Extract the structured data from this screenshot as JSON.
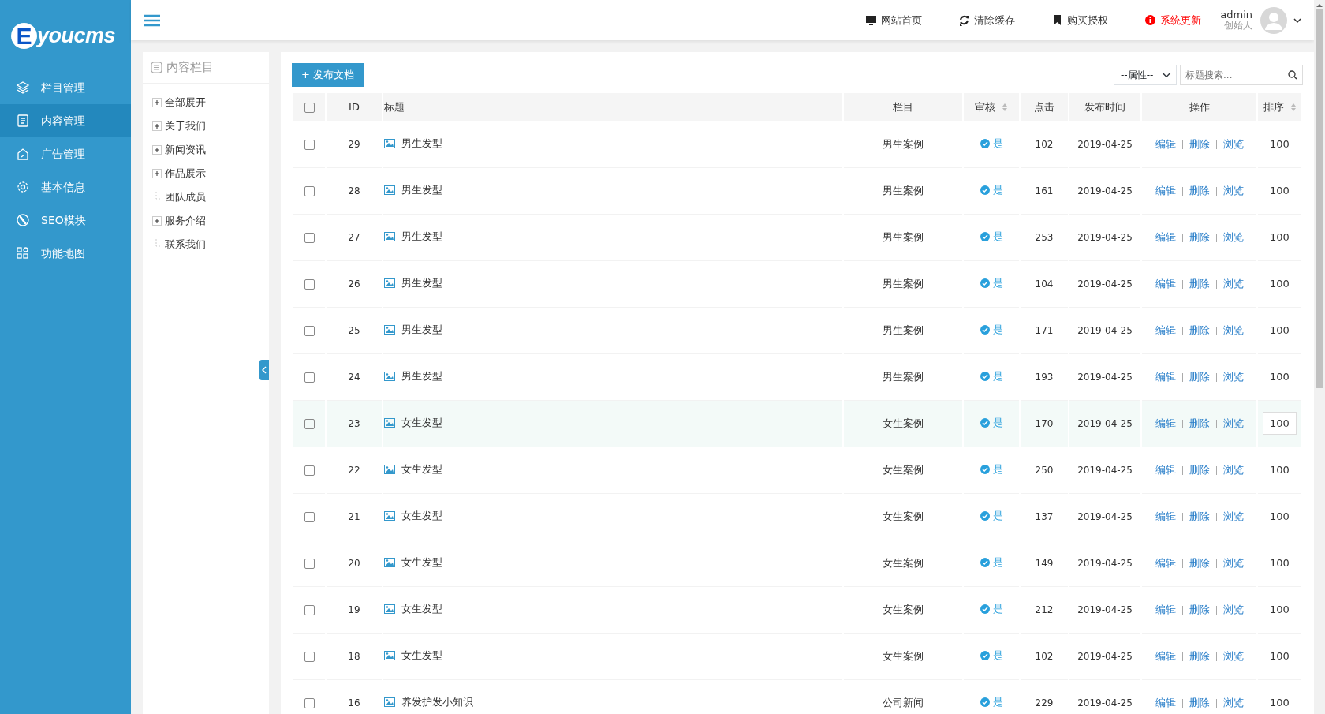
{
  "logo": {
    "letter": "E",
    "text": "youcms"
  },
  "sidebar": {
    "items": [
      {
        "label": "栏目管理",
        "selected": false
      },
      {
        "label": "内容管理",
        "selected": true
      },
      {
        "label": "广告管理",
        "selected": false
      },
      {
        "label": "基本信息",
        "selected": false
      },
      {
        "label": "SEO模块",
        "selected": false
      },
      {
        "label": "功能地图",
        "selected": false
      }
    ]
  },
  "topbar": {
    "links": [
      {
        "label": "网站首页",
        "kind": "normal"
      },
      {
        "label": "清除缓存",
        "kind": "normal"
      },
      {
        "label": "购买授权",
        "kind": "normal"
      },
      {
        "label": "系统更新",
        "kind": "alert"
      }
    ],
    "user": {
      "name": "admin",
      "role": "创始人"
    }
  },
  "tree": {
    "title": "内容栏目",
    "items": [
      {
        "label": "全部展开",
        "expandable": true
      },
      {
        "label": "关于我们",
        "expandable": true
      },
      {
        "label": "新闻资讯",
        "expandable": true
      },
      {
        "label": "作品展示",
        "expandable": true
      },
      {
        "label": "团队成员",
        "expandable": false
      },
      {
        "label": "服务介绍",
        "expandable": true
      },
      {
        "label": "联系我们",
        "expandable": false
      }
    ]
  },
  "toolbar": {
    "publish_button": "+ 发布文档",
    "filter": "--属性--",
    "search": {
      "placeholder": "标题搜索..."
    }
  },
  "table": {
    "select_all_checked": false,
    "columns": [
      {
        "label": "ID",
        "sortable": false
      },
      {
        "label": "标题",
        "sortable": false
      },
      {
        "label": "栏目",
        "sortable": false
      },
      {
        "label": "审核",
        "sortable": true
      },
      {
        "label": "点击",
        "sortable": false
      },
      {
        "label": "发布时间",
        "sortable": false
      },
      {
        "label": "操作",
        "sortable": false
      },
      {
        "label": "排序",
        "sortable": true
      }
    ],
    "rows": [
      {
        "id": "29",
        "title": "男生发型",
        "category": "男生案例",
        "approved": "是",
        "clicks": "102",
        "date": "2019-04-25",
        "actions": [
          "编辑",
          "删除",
          "浏览"
        ],
        "order": "100",
        "checked": false,
        "hovered": false
      },
      {
        "id": "28",
        "title": "男生发型",
        "category": "男生案例",
        "approved": "是",
        "clicks": "161",
        "date": "2019-04-25",
        "actions": [
          "编辑",
          "删除",
          "浏览"
        ],
        "order": "100",
        "checked": false,
        "hovered": false
      },
      {
        "id": "27",
        "title": "男生发型",
        "category": "男生案例",
        "approved": "是",
        "clicks": "253",
        "date": "2019-04-25",
        "actions": [
          "编辑",
          "删除",
          "浏览"
        ],
        "order": "100",
        "checked": false,
        "hovered": false
      },
      {
        "id": "26",
        "title": "男生发型",
        "category": "男生案例",
        "approved": "是",
        "clicks": "104",
        "date": "2019-04-25",
        "actions": [
          "编辑",
          "删除",
          "浏览"
        ],
        "order": "100",
        "checked": false,
        "hovered": false
      },
      {
        "id": "25",
        "title": "男生发型",
        "category": "男生案例",
        "approved": "是",
        "clicks": "171",
        "date": "2019-04-25",
        "actions": [
          "编辑",
          "删除",
          "浏览"
        ],
        "order": "100",
        "checked": false,
        "hovered": false
      },
      {
        "id": "24",
        "title": "男生发型",
        "category": "男生案例",
        "approved": "是",
        "clicks": "193",
        "date": "2019-04-25",
        "actions": [
          "编辑",
          "删除",
          "浏览"
        ],
        "order": "100",
        "checked": false,
        "hovered": false
      },
      {
        "id": "23",
        "title": "女生发型",
        "category": "女生案例",
        "approved": "是",
        "clicks": "170",
        "date": "2019-04-25",
        "actions": [
          "编辑",
          "删除",
          "浏览"
        ],
        "order": "100",
        "checked": false,
        "hovered": true
      },
      {
        "id": "22",
        "title": "女生发型",
        "category": "女生案例",
        "approved": "是",
        "clicks": "250",
        "date": "2019-04-25",
        "actions": [
          "编辑",
          "删除",
          "浏览"
        ],
        "order": "100",
        "checked": false,
        "hovered": false
      },
      {
        "id": "21",
        "title": "女生发型",
        "category": "女生案例",
        "approved": "是",
        "clicks": "137",
        "date": "2019-04-25",
        "actions": [
          "编辑",
          "删除",
          "浏览"
        ],
        "order": "100",
        "checked": false,
        "hovered": false
      },
      {
        "id": "20",
        "title": "女生发型",
        "category": "女生案例",
        "approved": "是",
        "clicks": "149",
        "date": "2019-04-25",
        "actions": [
          "编辑",
          "删除",
          "浏览"
        ],
        "order": "100",
        "checked": false,
        "hovered": false
      },
      {
        "id": "19",
        "title": "女生发型",
        "category": "女生案例",
        "approved": "是",
        "clicks": "212",
        "date": "2019-04-25",
        "actions": [
          "编辑",
          "删除",
          "浏览"
        ],
        "order": "100",
        "checked": false,
        "hovered": false
      },
      {
        "id": "18",
        "title": "女生发型",
        "category": "女生案例",
        "approved": "是",
        "clicks": "102",
        "date": "2019-04-25",
        "actions": [
          "编辑",
          "删除",
          "浏览"
        ],
        "order": "100",
        "checked": false,
        "hovered": false
      },
      {
        "id": "16",
        "title": "养发护发小知识",
        "category": "公司新闻",
        "approved": "是",
        "clicks": "229",
        "date": "2019-04-25",
        "actions": [
          "编辑",
          "删除",
          "浏览"
        ],
        "order": "100",
        "checked": false,
        "hovered": false
      }
    ]
  }
}
